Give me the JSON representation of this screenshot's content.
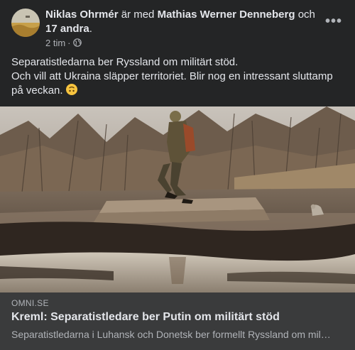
{
  "post": {
    "author": "Niklas Ohrmér",
    "with_text": "är med",
    "tagged_person": "Mathias Werner Denneberg",
    "and_text": "och",
    "others": "17 andra",
    "period": ".",
    "time": "2 tim",
    "separator": "·",
    "audience_icon": "globe-icon",
    "more_icon": "more-options-icon",
    "more_glyph": "•••",
    "text_lines": [
      "Separatistledarna ber Ryssland om militärt stöd.",
      "Och vill att Ukraina släpper territoriet. Blir nog en intressant sluttamp",
      "på veckan."
    ],
    "emoji": "upside-down-face-emoji"
  },
  "link_preview": {
    "domain": "OMNI.SE",
    "title": "Kreml: Separatistledare ber Putin om militärt stöd",
    "description": "Separatistledarna i Luhansk och Donetsk ber formellt Ryssland om militärt stöd"
  },
  "colors": {
    "background": "#242526",
    "card": "#3a3b3c",
    "primary_text": "#e4e6eb",
    "secondary_text": "#b0b3b8"
  }
}
